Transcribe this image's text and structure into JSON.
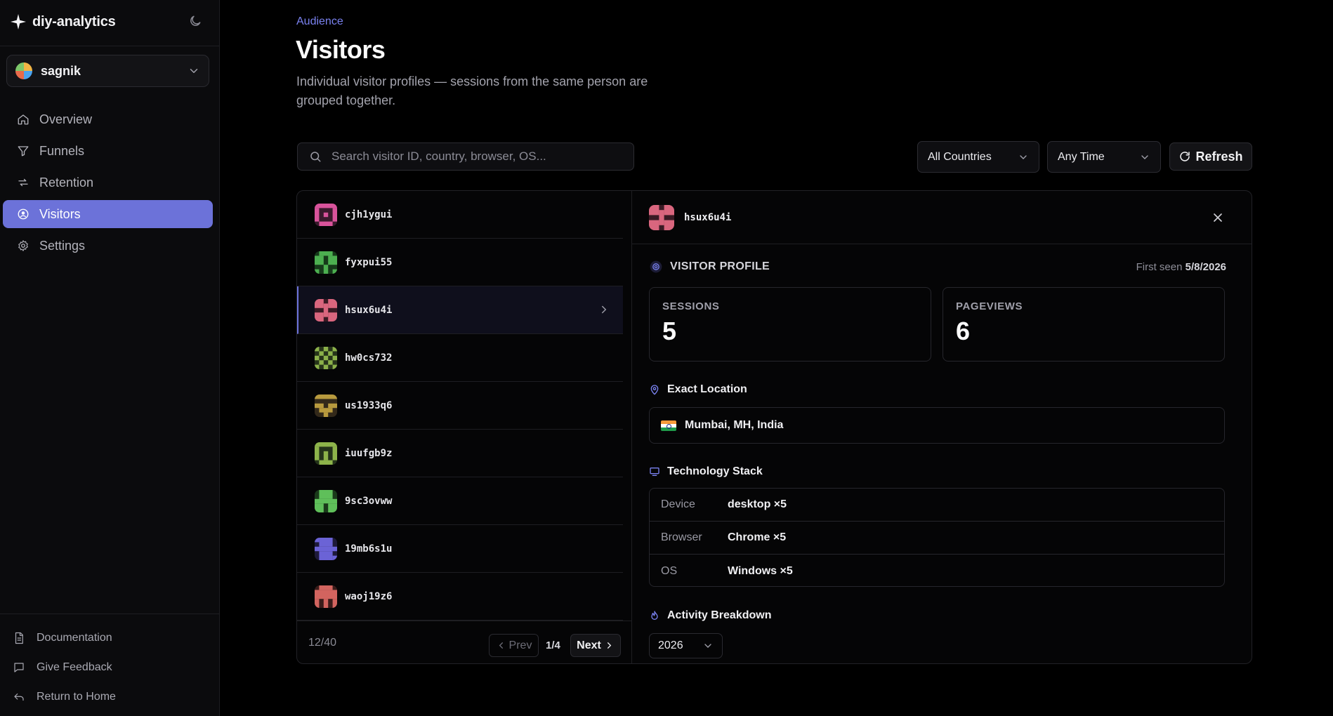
{
  "app": {
    "name": "diy-analytics"
  },
  "workspace": {
    "name": "sagnik"
  },
  "nav": [
    {
      "label": "Overview",
      "icon": "home-icon",
      "active": false
    },
    {
      "label": "Funnels",
      "icon": "funnel-icon",
      "active": false
    },
    {
      "label": "Retention",
      "icon": "retention-icon",
      "active": false
    },
    {
      "label": "Visitors",
      "icon": "visitor-icon",
      "active": true
    },
    {
      "label": "Settings",
      "icon": "gear-icon",
      "active": false
    }
  ],
  "footer": {
    "documentation": "Documentation",
    "feedback": "Give Feedback",
    "home": "Return to Home"
  },
  "page": {
    "breadcrumb": "Audience",
    "title": "Visitors",
    "subtitle": "Individual visitor profiles — sessions from the same person are grouped together."
  },
  "toolbar": {
    "search_placeholder": "Search visitor ID, country, browser, OS...",
    "country_filter": "All Countries",
    "time_filter": "Any Time",
    "refresh_label": "Refresh"
  },
  "visitors": [
    {
      "id": "cjh1ygui",
      "color": "#d9539b"
    },
    {
      "id": "fyxpui55",
      "color": "#4caf50"
    },
    {
      "id": "hsux6u4i",
      "color": "#d9667e",
      "selected": true
    },
    {
      "id": "hw0cs732",
      "color": "#8bb04a"
    },
    {
      "id": "us1933q6",
      "color": "#b89a3e"
    },
    {
      "id": "iuufgb9z",
      "color": "#8db34a"
    },
    {
      "id": "9sc3ovww",
      "color": "#5fbf5a"
    },
    {
      "id": "19mb6s1u",
      "color": "#6b63d6"
    },
    {
      "id": "waoj19z6",
      "color": "#d2645f"
    }
  ],
  "pagination": {
    "count": "12/40",
    "prev": "Prev",
    "page": "1/4",
    "next": "Next"
  },
  "detail": {
    "visitor_id": "hsux6u4i",
    "profile_label": "VISITOR PROFILE",
    "first_seen_label": "First seen",
    "first_seen_date": "5/8/2026",
    "sessions_label": "SESSIONS",
    "sessions_value": "5",
    "pageviews_label": "PAGEVIEWS",
    "pageviews_value": "6",
    "location_heading": "Exact Location",
    "location": "Mumbai, MH, India",
    "tech_heading": "Technology Stack",
    "tech": [
      {
        "key": "Device",
        "value": "desktop ×5"
      },
      {
        "key": "Browser",
        "value": "Chrome ×5"
      },
      {
        "key": "OS",
        "value": "Windows ×5"
      }
    ],
    "activity_heading": "Activity Breakdown",
    "year": "2026"
  },
  "colors": {
    "accent": "#6c72d9",
    "background": "#000000"
  }
}
